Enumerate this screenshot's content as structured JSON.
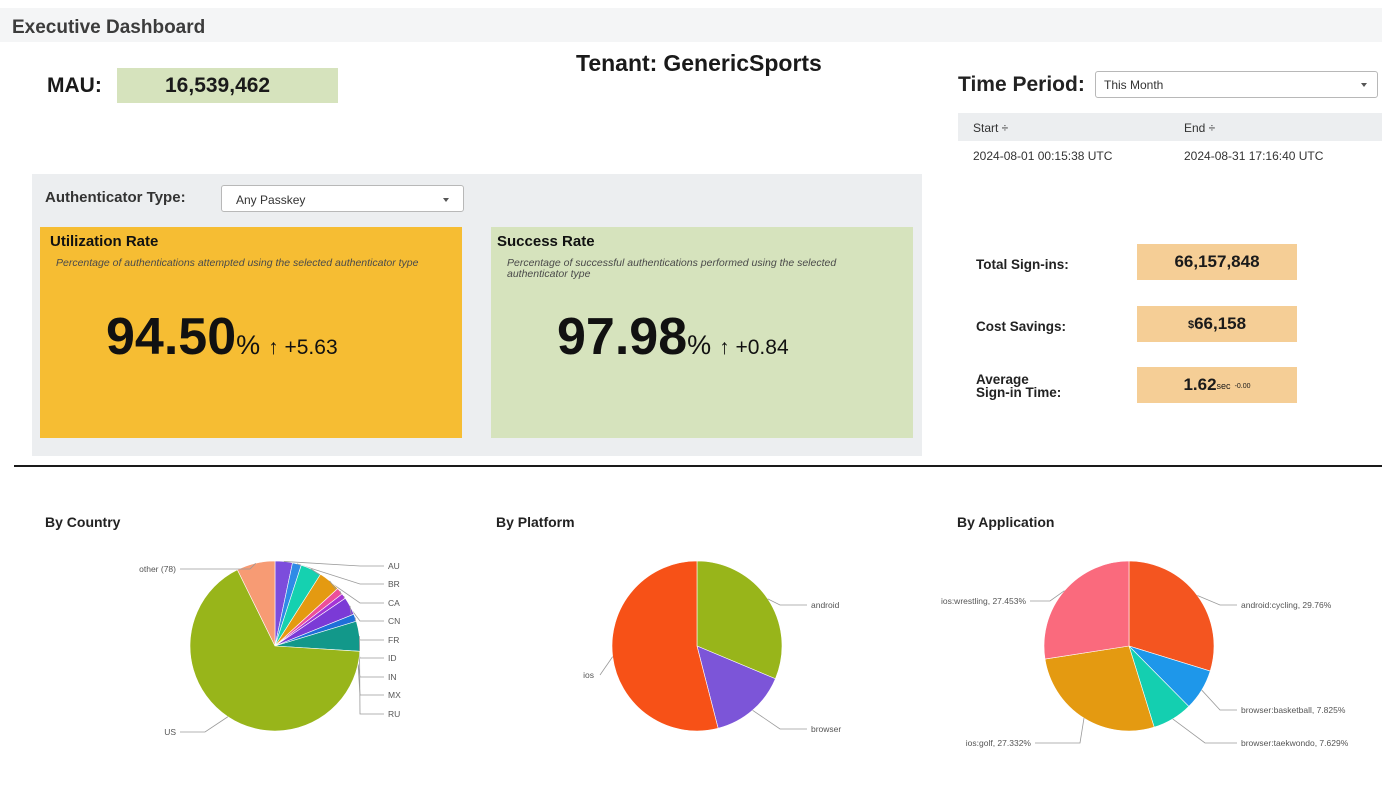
{
  "header": {
    "title": "Executive Dashboard"
  },
  "tenant": {
    "label": "Tenant:",
    "name": "GenericSports"
  },
  "mau": {
    "label": "MAU:",
    "value": "16,539,462"
  },
  "time_period": {
    "label": "Time Period:",
    "selected": "This Month",
    "columns": [
      "Start ÷",
      "End ÷"
    ],
    "start": "2024-08-01 00:15:38 UTC",
    "end": "2024-08-31 17:16:40 UTC"
  },
  "authenticator": {
    "label": "Authenticator Type:",
    "selected": "Any Passkey"
  },
  "utilization": {
    "title": "Utilization Rate",
    "description": "Percentage of authentications attempted using the selected authenticator type",
    "value": "94.50",
    "unit": "%",
    "delta": "↑ +5.63",
    "color": "#f6bd33"
  },
  "success": {
    "title": "Success Rate",
    "description": "Percentage of successful authentications performed using the selected authenticator type",
    "value": "97.98",
    "unit": "%",
    "delta": "↑ +0.84",
    "color": "#d6e3bd"
  },
  "kpis": {
    "total_signins": {
      "label": "Total Sign-ins:",
      "value": "66,157,848"
    },
    "cost_savings": {
      "label": "Cost Savings:",
      "currency": "$",
      "value": "66,158"
    },
    "avg_signin_time": {
      "label_line1": "Average",
      "label_line2": "Sign-in Time:",
      "value": "1.62",
      "unit": "sec",
      "delta": "-0.00"
    }
  },
  "sections": {
    "country": "By Country",
    "platform": "By Platform",
    "application": "By Application"
  },
  "chart_data": [
    {
      "type": "pie",
      "title": "By Country",
      "slices": [
        {
          "label": "AU",
          "value": 3.3,
          "color": "#7c4ddc"
        },
        {
          "label": "BR",
          "value": 1.7,
          "color": "#2f8be6"
        },
        {
          "label": "CA",
          "value": 4.0,
          "color": "#15d1b0"
        },
        {
          "label": "CN",
          "value": 4.2,
          "color": "#e49a11"
        },
        {
          "label": "FR",
          "value": 1.3,
          "color": "#ec4f9a"
        },
        {
          "label": "ID",
          "value": 1.0,
          "color": "#a434d6"
        },
        {
          "label": "IN",
          "value": 3.4,
          "color": "#7b3ad6"
        },
        {
          "label": "MX",
          "value": 1.4,
          "color": "#1f6fd8"
        },
        {
          "label": "RU",
          "value": 5.7,
          "color": "#12988a"
        },
        {
          "label": "US",
          "value": 66.7,
          "color": "#98b51a"
        },
        {
          "label": "other (78)",
          "value": 7.3,
          "color": "#f79b74"
        }
      ]
    },
    {
      "type": "pie",
      "title": "By Platform",
      "slices": [
        {
          "label": "android",
          "value": 31.3,
          "color": "#98b51a"
        },
        {
          "label": "browser",
          "value": 14.7,
          "color": "#7c55d8"
        },
        {
          "label": "ios",
          "value": 54.0,
          "color": "#f75117"
        }
      ]
    },
    {
      "type": "pie",
      "title": "By Application",
      "slices": [
        {
          "label": "android:cycling, 29.76%",
          "value": 29.76,
          "color": "#f45520"
        },
        {
          "label": "browser:basketball, 7.825%",
          "value": 7.825,
          "color": "#1e97ea"
        },
        {
          "label": "browser:taekwondo, 7.629%",
          "value": 7.629,
          "color": "#14cfb0"
        },
        {
          "label": "ios:golf, 27.332%",
          "value": 27.332,
          "color": "#e49a11"
        },
        {
          "label": "ios:wrestling, 27.453%",
          "value": 27.453,
          "color": "#fa6a7d"
        }
      ]
    }
  ]
}
